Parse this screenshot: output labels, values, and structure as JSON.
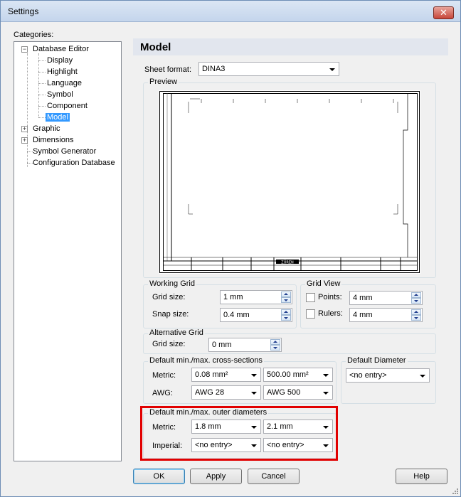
{
  "window": {
    "title": "Settings",
    "close_glyph": "✕"
  },
  "categories": {
    "label": "Categories:",
    "items": [
      {
        "label": "Database Editor",
        "expander": "−"
      },
      {
        "label": "Display"
      },
      {
        "label": "Highlight"
      },
      {
        "label": "Language"
      },
      {
        "label": "Symbol"
      },
      {
        "label": "Component"
      },
      {
        "label": "Model",
        "selected": true
      },
      {
        "label": "Graphic",
        "expander": "+"
      },
      {
        "label": "Dimensions",
        "expander": "+"
      },
      {
        "label": "Symbol Generator"
      },
      {
        "label": "Configuration Database"
      }
    ]
  },
  "panel": {
    "title": "Model",
    "sheet_format": {
      "label": "Sheet format:",
      "value": "DINA3"
    },
    "preview": {
      "label": "Preview",
      "company_text": "ZÜREN"
    },
    "working_grid": {
      "title": "Working Grid",
      "grid_size": {
        "label": "Grid size:",
        "value": "1 mm"
      },
      "snap_size": {
        "label": "Snap size:",
        "value": "0.4 mm"
      }
    },
    "grid_view": {
      "title": "Grid View",
      "points": {
        "label": "Points:",
        "value": "4 mm",
        "checked": false
      },
      "rulers": {
        "label": "Rulers:",
        "value": "4 mm",
        "checked": false
      }
    },
    "alternative_grid": {
      "title": "Alternative Grid",
      "grid_size": {
        "label": "Grid size:",
        "value": "0 mm"
      }
    },
    "cross_sections": {
      "title": "Default min./max. cross-sections",
      "metric": {
        "label": "Metric:",
        "min": "0.08 mm²",
        "max": "500.00 mm²"
      },
      "awg": {
        "label": "AWG:",
        "min": "AWG 28",
        "max": "AWG 500"
      }
    },
    "default_diameter": {
      "title": "Default Diameter",
      "value": "<no entry>"
    },
    "outer_diameters": {
      "title": "Default min./max. outer diameters",
      "metric": {
        "label": "Metric:",
        "min": "1.8 mm",
        "max": "2.1 mm"
      },
      "imperial": {
        "label": "Imperial:",
        "min": "<no entry>",
        "max": "<no entry>"
      }
    }
  },
  "buttons": {
    "ok": "OK",
    "apply": "Apply",
    "cancel": "Cancel",
    "help": "Help"
  },
  "colors": {
    "highlight": "#e10000",
    "selection": "#3399ff",
    "header_bar": "#e2e6ee"
  },
  "icons": [
    "close-icon",
    "chevron-down-icon",
    "spin-up-icon",
    "spin-down-icon",
    "tree-expander-icon",
    "resize-grip-icon"
  ]
}
